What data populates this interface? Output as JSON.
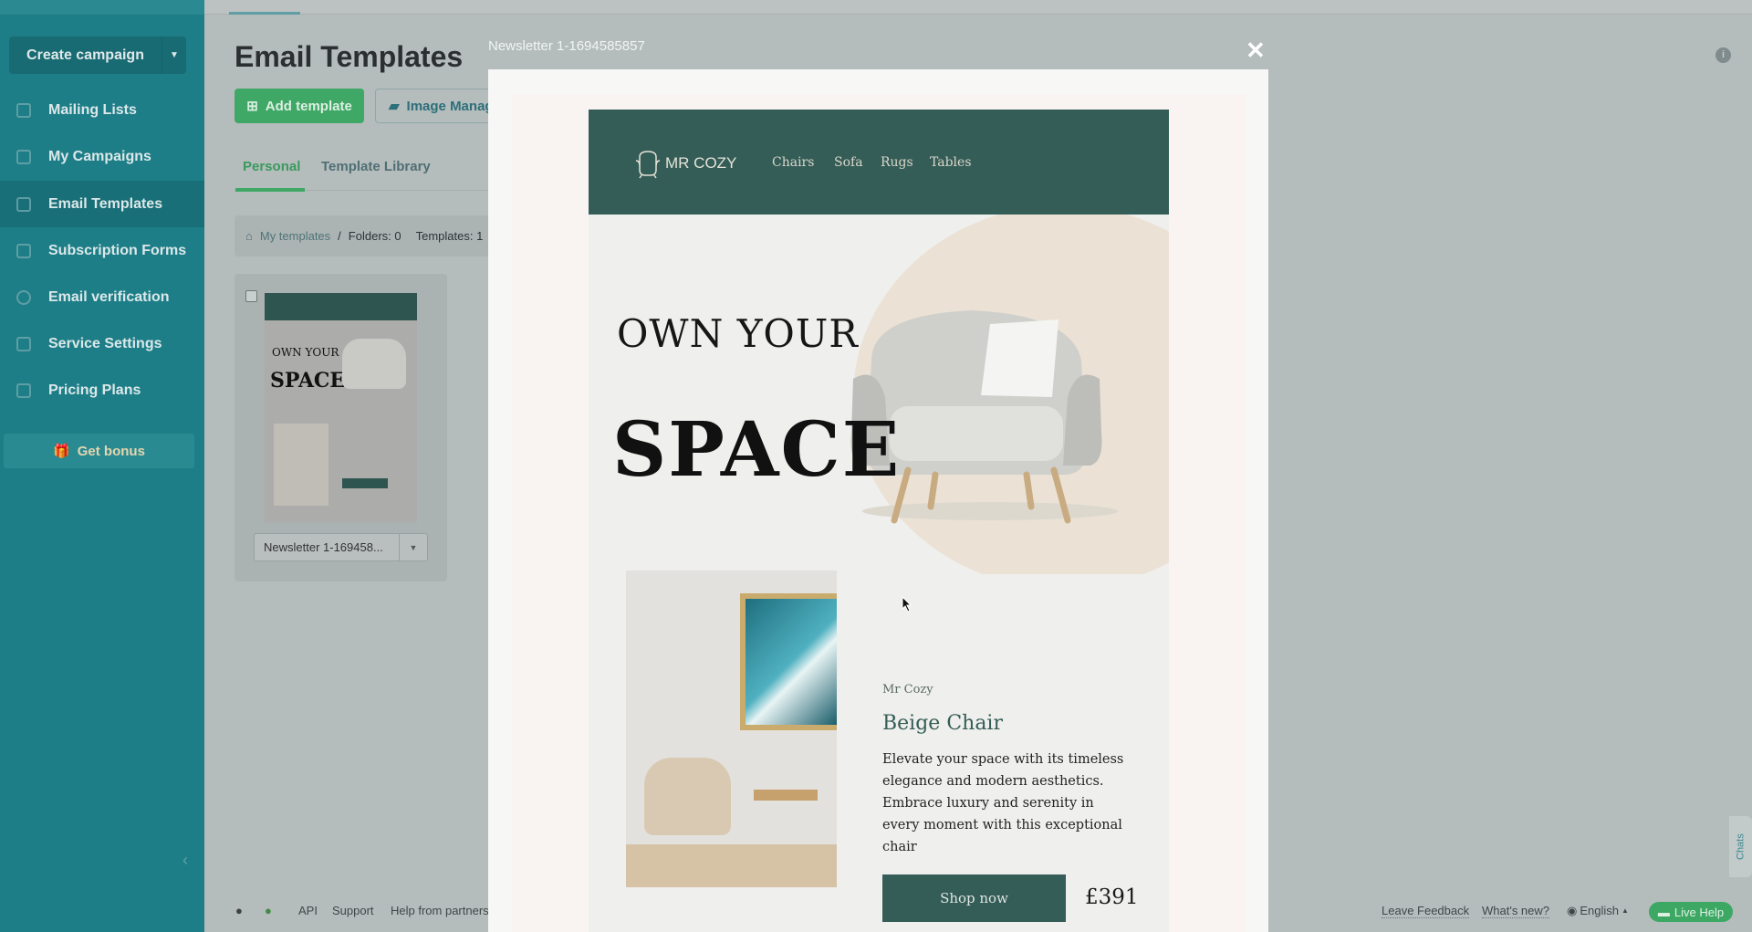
{
  "colors": {
    "sidebar": "#1d7e87",
    "accent_green": "#3fa866",
    "email_header": "#345d57"
  },
  "sidebar": {
    "create_campaign": "Create campaign",
    "items": [
      {
        "label": "Mailing Lists",
        "icon": "address-book-icon"
      },
      {
        "label": "My Campaigns",
        "icon": "upload-icon"
      },
      {
        "label": "Email Templates",
        "icon": "template-icon",
        "active": true
      },
      {
        "label": "Subscription Forms",
        "icon": "form-icon"
      },
      {
        "label": "Email verification",
        "icon": "check-circle-icon"
      },
      {
        "label": "Service Settings",
        "icon": "settings-icon"
      },
      {
        "label": "Pricing Plans",
        "icon": "pricing-icon"
      }
    ],
    "get_bonus": "Get bonus"
  },
  "main": {
    "title": "Email Templates",
    "add_template": "Add template",
    "image_manager": "Image Manager",
    "tabs": [
      {
        "label": "Personal",
        "active": true
      },
      {
        "label": "Template Library"
      }
    ],
    "breadcrumb": {
      "root": "My templates",
      "sep": "/",
      "folders": "Folders: 0",
      "templates": "Templates: 1"
    },
    "card": {
      "name": "Newsletter 1-169458...",
      "thumb_text1": "OWN YOUR",
      "thumb_text2": "SPACE"
    }
  },
  "modal": {
    "title": "Newsletter 1-1694585857",
    "close": "✕",
    "email": {
      "brand": "MR COZY",
      "nav": [
        "Chairs",
        "Sofa",
        "Rugs",
        "Tables"
      ],
      "hero1": "OWN YOUR",
      "hero2": "SPACE",
      "kicker": "Mr Cozy",
      "product": "Beige Chair",
      "desc": "Elevate your space with its timeless elegance and modern aesthetics. Embrace luxury and serenity in every moment with this exceptional chair",
      "cta": "Shop now",
      "price": "£391"
    }
  },
  "footer": {
    "links": [
      "API",
      "Support",
      "Help from partners"
    ],
    "right": {
      "feedback": "Leave Feedback",
      "whats_new": "What's new?",
      "language": "English",
      "live_help": "Live Help"
    }
  },
  "chats": "Chats"
}
